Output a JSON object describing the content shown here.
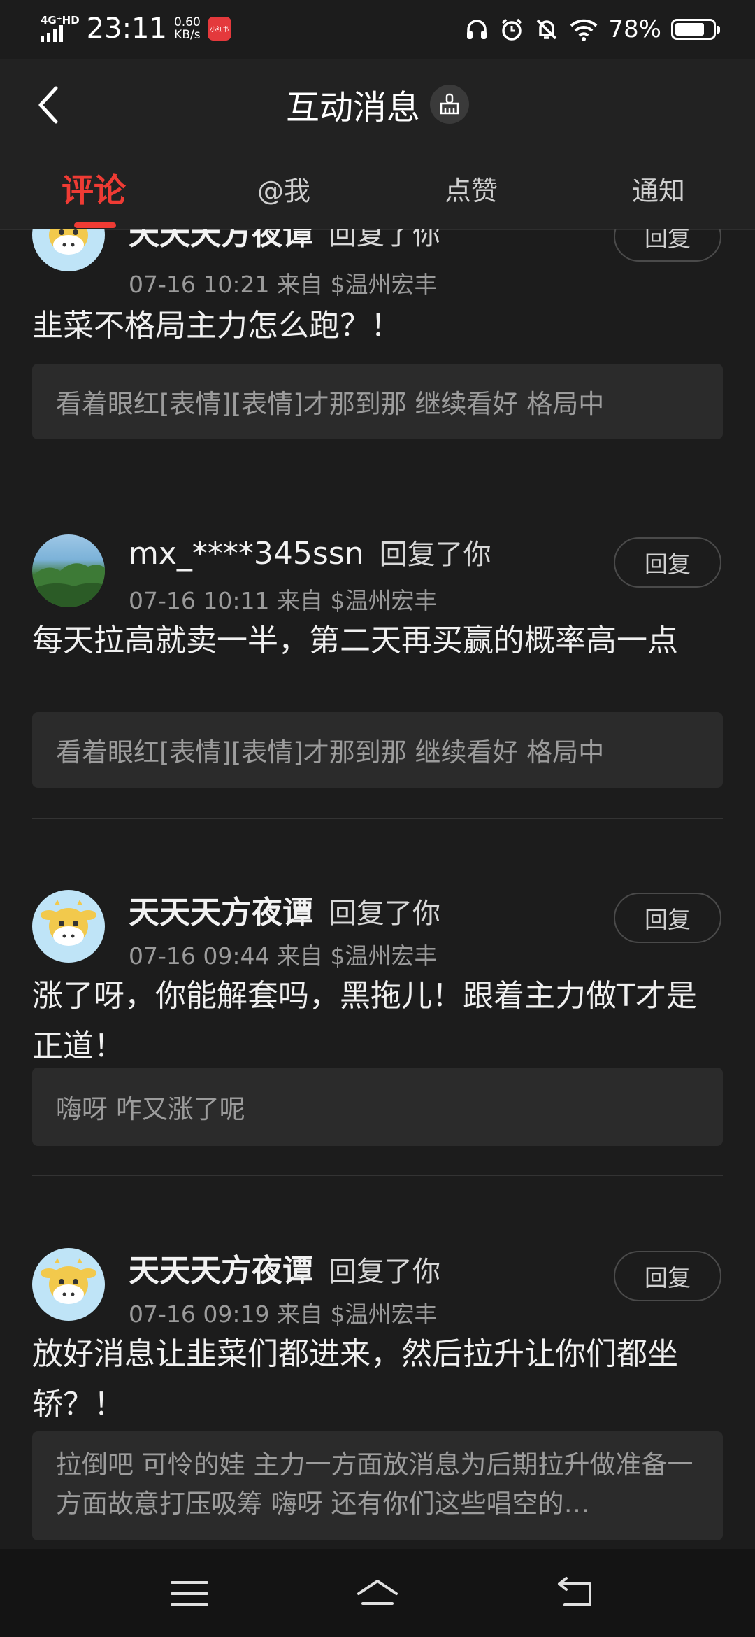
{
  "status_bar": {
    "network": "4G⁺HD",
    "time": "23:11",
    "speed_value": "0.60",
    "speed_unit": "KB/s",
    "app_badge": "小红书",
    "battery_percent": "78%",
    "battery_level": 0.78,
    "icons": [
      "headphones-icon",
      "alarm-icon",
      "mute-icon",
      "wifi-icon",
      "battery-icon"
    ]
  },
  "header": {
    "title": "互动消息",
    "back_icon": "chevron-left-icon",
    "clear_icon": "broom-icon"
  },
  "tabs": [
    {
      "label": "评论",
      "active": true
    },
    {
      "label": "@我",
      "active": false
    },
    {
      "label": "点赞",
      "active": false
    },
    {
      "label": "通知",
      "active": false
    }
  ],
  "messages": [
    {
      "user": "天天天方夜谭",
      "action": "回复了你",
      "meta": "07-16 10:21 来自 $温州宏丰",
      "reply_label": "回复",
      "comment": "韭菜不格局主力怎么跑？！",
      "quote": "看着眼红[表情][表情]才那到那 继续看好 格局中",
      "avatar": "cow"
    },
    {
      "user": "mx_****345ssn",
      "action": "回复了你",
      "meta": "07-16 10:11 来自 $温州宏丰",
      "reply_label": "回复",
      "comment": "每天拉高就卖一半，第二天再买赢的概率高一点",
      "quote": "看着眼红[表情][表情]才那到那 继续看好 格局中",
      "avatar": "mountain"
    },
    {
      "user": "天天天方夜谭",
      "action": "回复了你",
      "meta": "07-16 09:44 来自 $温州宏丰",
      "reply_label": "回复",
      "comment": "涨了呀，你能解套吗，黑拖儿！跟着主力做T才是正道！",
      "quote": "嗨呀 咋又涨了呢",
      "avatar": "cow"
    },
    {
      "user": "天天天方夜谭",
      "action": "回复了你",
      "meta": "07-16 09:19 来自 $温州宏丰",
      "reply_label": "回复",
      "comment": "放好消息让韭菜们都进来，然后拉升让你们都坐轿？！",
      "quote": "拉倒吧 可怜的娃 主力一方面放消息为后期拉升做准备一方面故意打压吸筹 嗨呀 还有你们这些唱空的…",
      "avatar": "cow"
    }
  ],
  "nav_bar": {
    "icons": [
      "menu-icon",
      "home-icon",
      "back-icon"
    ]
  }
}
